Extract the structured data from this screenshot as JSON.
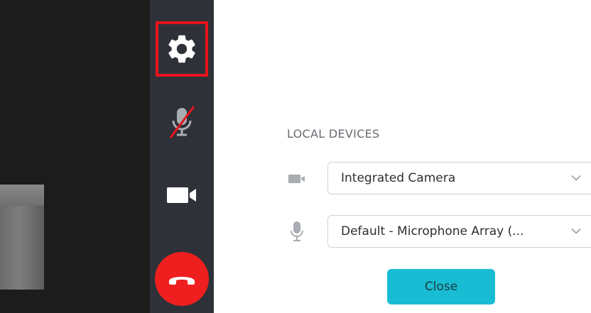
{
  "panel": {
    "section_title": "LOCAL DEVICES",
    "camera": {
      "icon": "video-camera-icon",
      "selected": "Integrated Camera"
    },
    "microphone": {
      "icon": "microphone-icon",
      "selected": "Default - Microphone Array (..."
    },
    "close_label": "Close"
  },
  "toolbar": {
    "settings_icon": "gear-icon",
    "mic_icon": "microphone-muted-icon",
    "camera_icon": "video-camera-icon",
    "hangup_icon": "phone-hangup-icon"
  },
  "colors": {
    "toolbar_bg": "#2e3238",
    "highlight": "#e8141c",
    "hangup": "#ef1f1f",
    "close_button": "#19bdd3"
  }
}
